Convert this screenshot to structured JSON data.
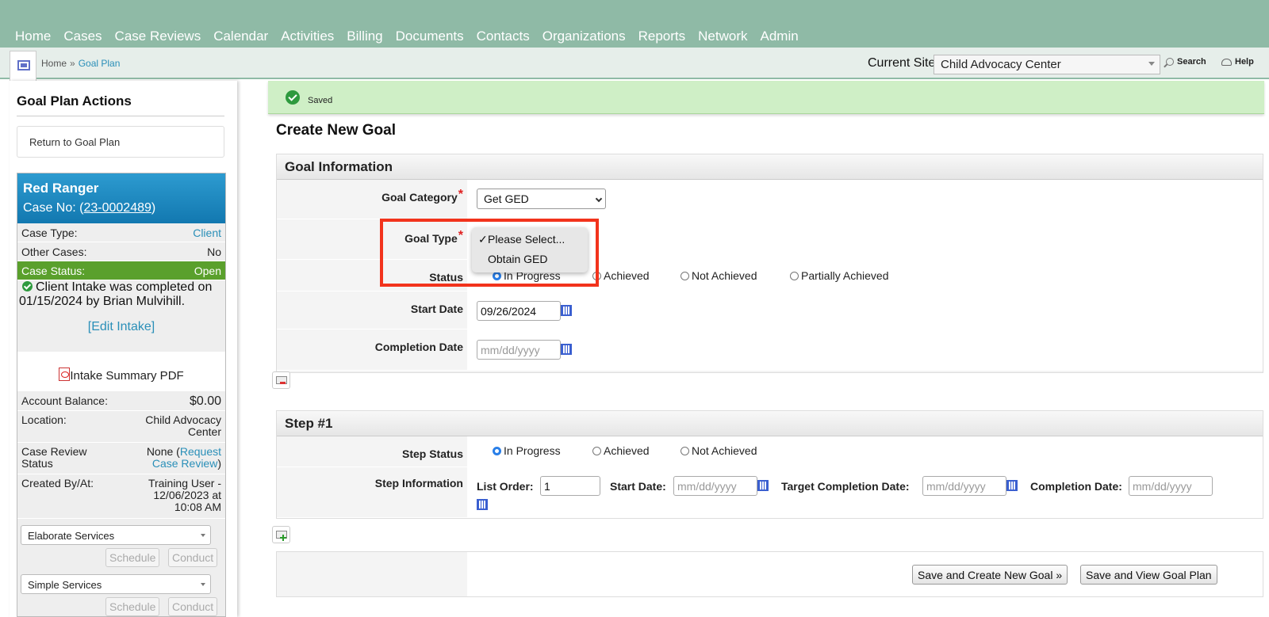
{
  "nav": {
    "items": [
      "Home",
      "Cases",
      "Case Reviews",
      "Calendar",
      "Activities",
      "Billing",
      "Documents",
      "Contacts",
      "Organizations",
      "Reports",
      "Network",
      "Admin"
    ]
  },
  "breadcrumb": {
    "home": "Home",
    "sep": "»",
    "current": "Goal Plan"
  },
  "site": {
    "label": "Current Site",
    "value": "Child Advocacy Center"
  },
  "header_links": {
    "search": "Search",
    "help": "Help"
  },
  "sidebar": {
    "title": "Goal Plan Actions",
    "return_link": "Return to Goal Plan",
    "case": {
      "name": "Red Ranger",
      "case_no_label": "Case No: (",
      "case_no": "23-0002489",
      "case_no_close": ")",
      "type_label": "Case Type:",
      "type_value": "Client",
      "other_label": "Other Cases:",
      "other_value": "No",
      "status_label": "Case Status:",
      "status_value": "Open",
      "intake_msg": "Client Intake was completed on 01/15/2024 by Brian Mulvihill.",
      "edit_intake": "[Edit Intake]",
      "intake_pdf": "Intake Summary PDF",
      "balance_label": "Account Balance:",
      "balance_value": "$0.00",
      "location_label": "Location:",
      "location_value": "Child Advocacy Center",
      "review_label": "Case Review Status",
      "review_value_prefix": "None (",
      "review_link": "Request Case Review",
      "review_value_suffix": ")",
      "created_label": "Created By/At:",
      "created_value": "Training User - 12/06/2023 at 10:08 AM"
    },
    "services": [
      {
        "select": "Elaborate Services",
        "schedule": "Schedule",
        "conduct": "Conduct"
      },
      {
        "select": "Simple Services",
        "schedule": "Schedule",
        "conduct": "Conduct"
      }
    ]
  },
  "saved": {
    "text": "Saved"
  },
  "page_title": "Create New Goal",
  "goal_info": {
    "heading": "Goal Information",
    "category_label": "Goal Category",
    "category_value": "Get GED",
    "type_label": "Goal Type",
    "status_label": "Status",
    "status_options": [
      "In Progress",
      "Achieved",
      "Not Achieved",
      "Partially Achieved"
    ],
    "start_label": "Start Date",
    "start_value": "09/26/2024",
    "completion_label": "Completion Date",
    "completion_placeholder": "mm/dd/yyyy",
    "required_mark": "*"
  },
  "goal_type_dropdown": {
    "options": [
      "Please Select...",
      "Obtain GED"
    ],
    "check": "✓"
  },
  "step": {
    "heading": "Step #1",
    "status_label": "Step Status",
    "status_options": [
      "In Progress",
      "Achieved",
      "Not Achieved"
    ],
    "info_label": "Step Information",
    "list_order_label": "List Order:",
    "list_order_value": "1",
    "start_label": "Start Date:",
    "target_label": "Target Completion Date:",
    "completion_label": "Completion Date:",
    "date_placeholder": "mm/dd/yyyy"
  },
  "actions": {
    "save_new": "Save and Create New Goal »",
    "save_view": "Save and View Goal Plan"
  },
  "colors": {
    "nav": "#8fbaa6",
    "accent": "#2a8fb8",
    "status_open": "#5aa02c",
    "highlight": "#f2331c"
  }
}
